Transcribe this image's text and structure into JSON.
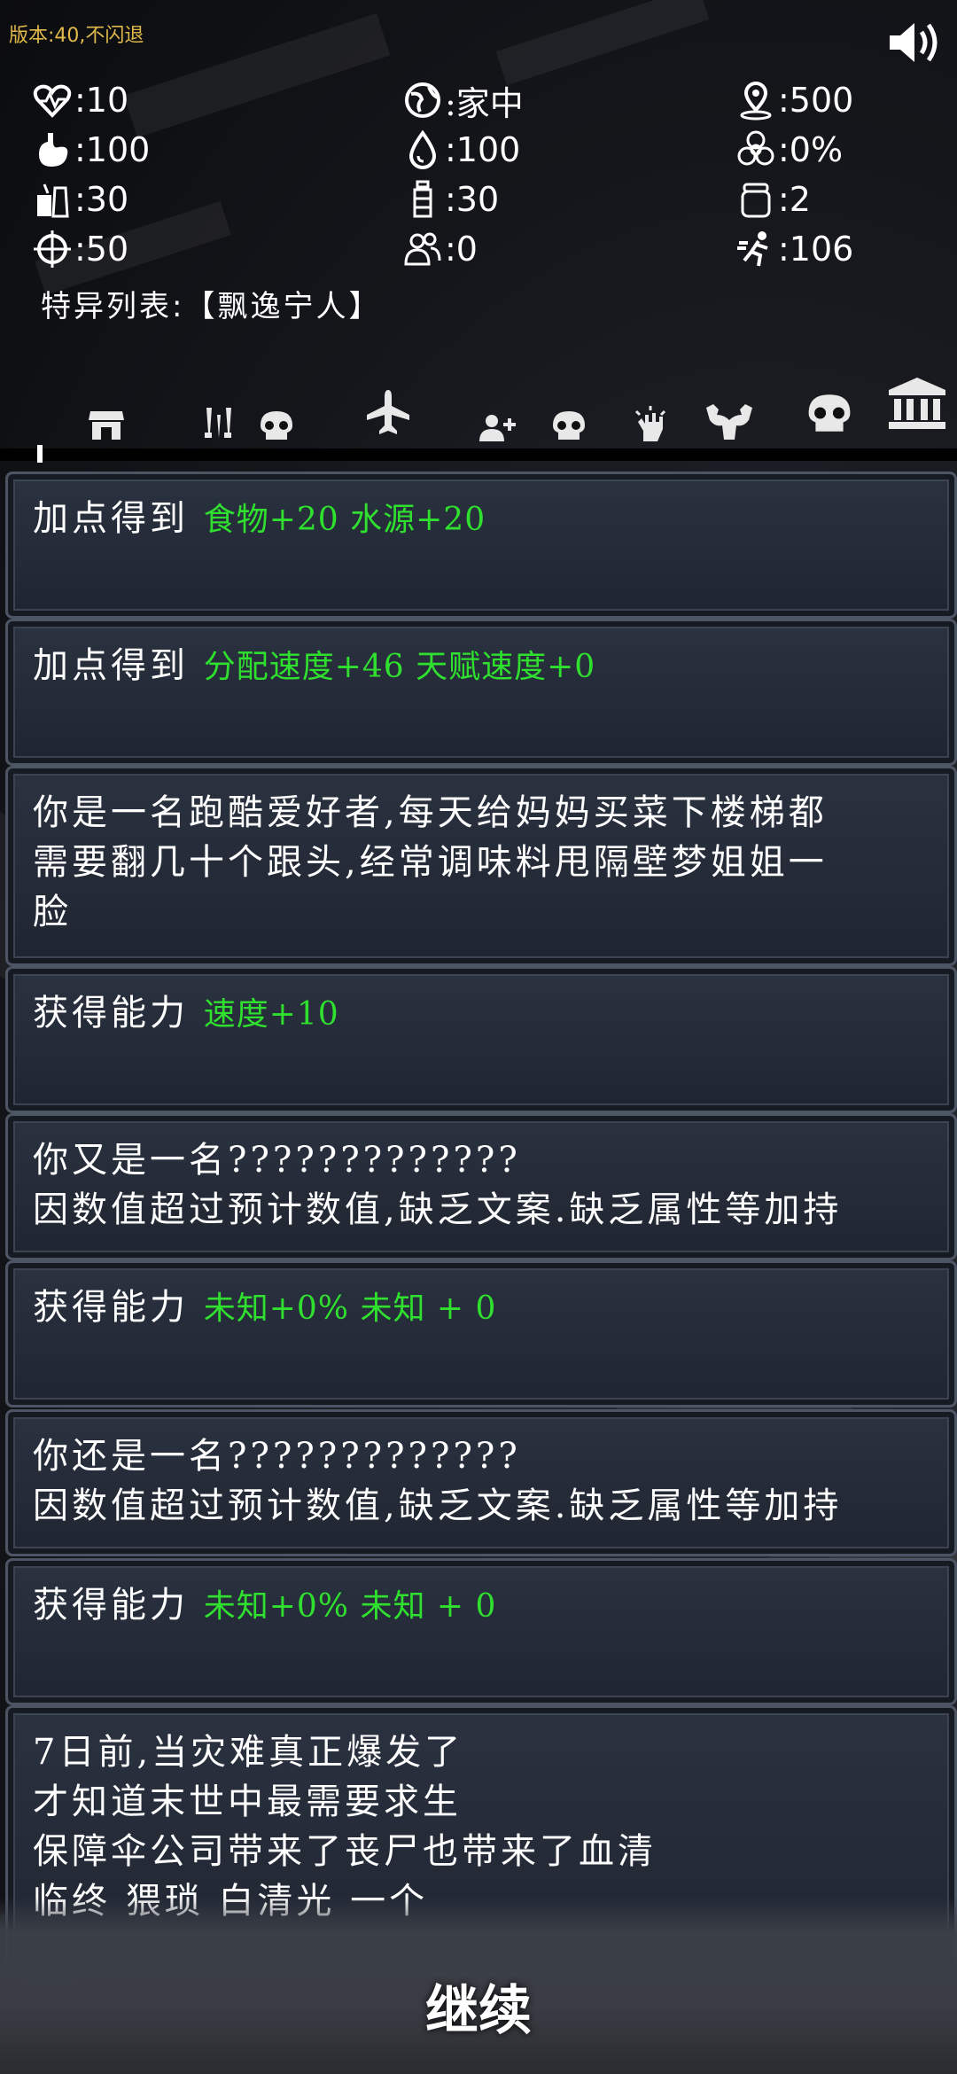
{
  "version": "版本:40,不闪退",
  "stats": {
    "hp": ":10",
    "location": ":家中",
    "distance": ":500",
    "stomach": ":100",
    "water": ":100",
    "infection": ":0%",
    "food": ":30",
    "bottle": ":30",
    "jar": ":2",
    "aim": ":50",
    "people": ":0",
    "speed": ":106"
  },
  "special": "特异列表:【飘逸宁人】",
  "tabs": [
    "store-icon",
    "weapon-icon",
    "skull-icon",
    "plane-icon",
    "add-user-icon",
    "skull-icon",
    "fist-icon",
    "muscle-icon",
    "skull-icon",
    "bank-icon"
  ],
  "cards": [
    {
      "prefix": "加点得到",
      "green": "食物+20  水源+20"
    },
    {
      "prefix": "加点得到",
      "green": "分配速度+46  天赋速度+0"
    },
    {
      "lines": [
        "你是一名跑酷爱好者,每天给妈妈买菜下楼梯都",
        "需要翻几十个跟头,经常调味料甩隔壁梦姐姐一",
        "脸"
      ]
    },
    {
      "prefix": "获得能力",
      "green": "速度+10"
    },
    {
      "lines": [
        "你又是一名?????????????",
        "因数值超过预计数值,缺乏文案.缺乏属性等加持"
      ]
    },
    {
      "prefix": "获得能力",
      "green": " 未知+0%  未知 + 0"
    },
    {
      "lines": [
        "你还是一名?????????????",
        "因数值超过预计数值,缺乏文案.缺乏属性等加持"
      ]
    },
    {
      "prefix": "获得能力",
      "green": " 未知+0%  未知 + 0"
    },
    {
      "lines": [
        "7日前,当灾难真正爆发了",
        "才知道末世中最需要求生",
        "保障伞公司带来了丧尸也带来了血清",
        "临终 猥琐 白清光 一个"
      ]
    }
  ],
  "continue": "继续"
}
